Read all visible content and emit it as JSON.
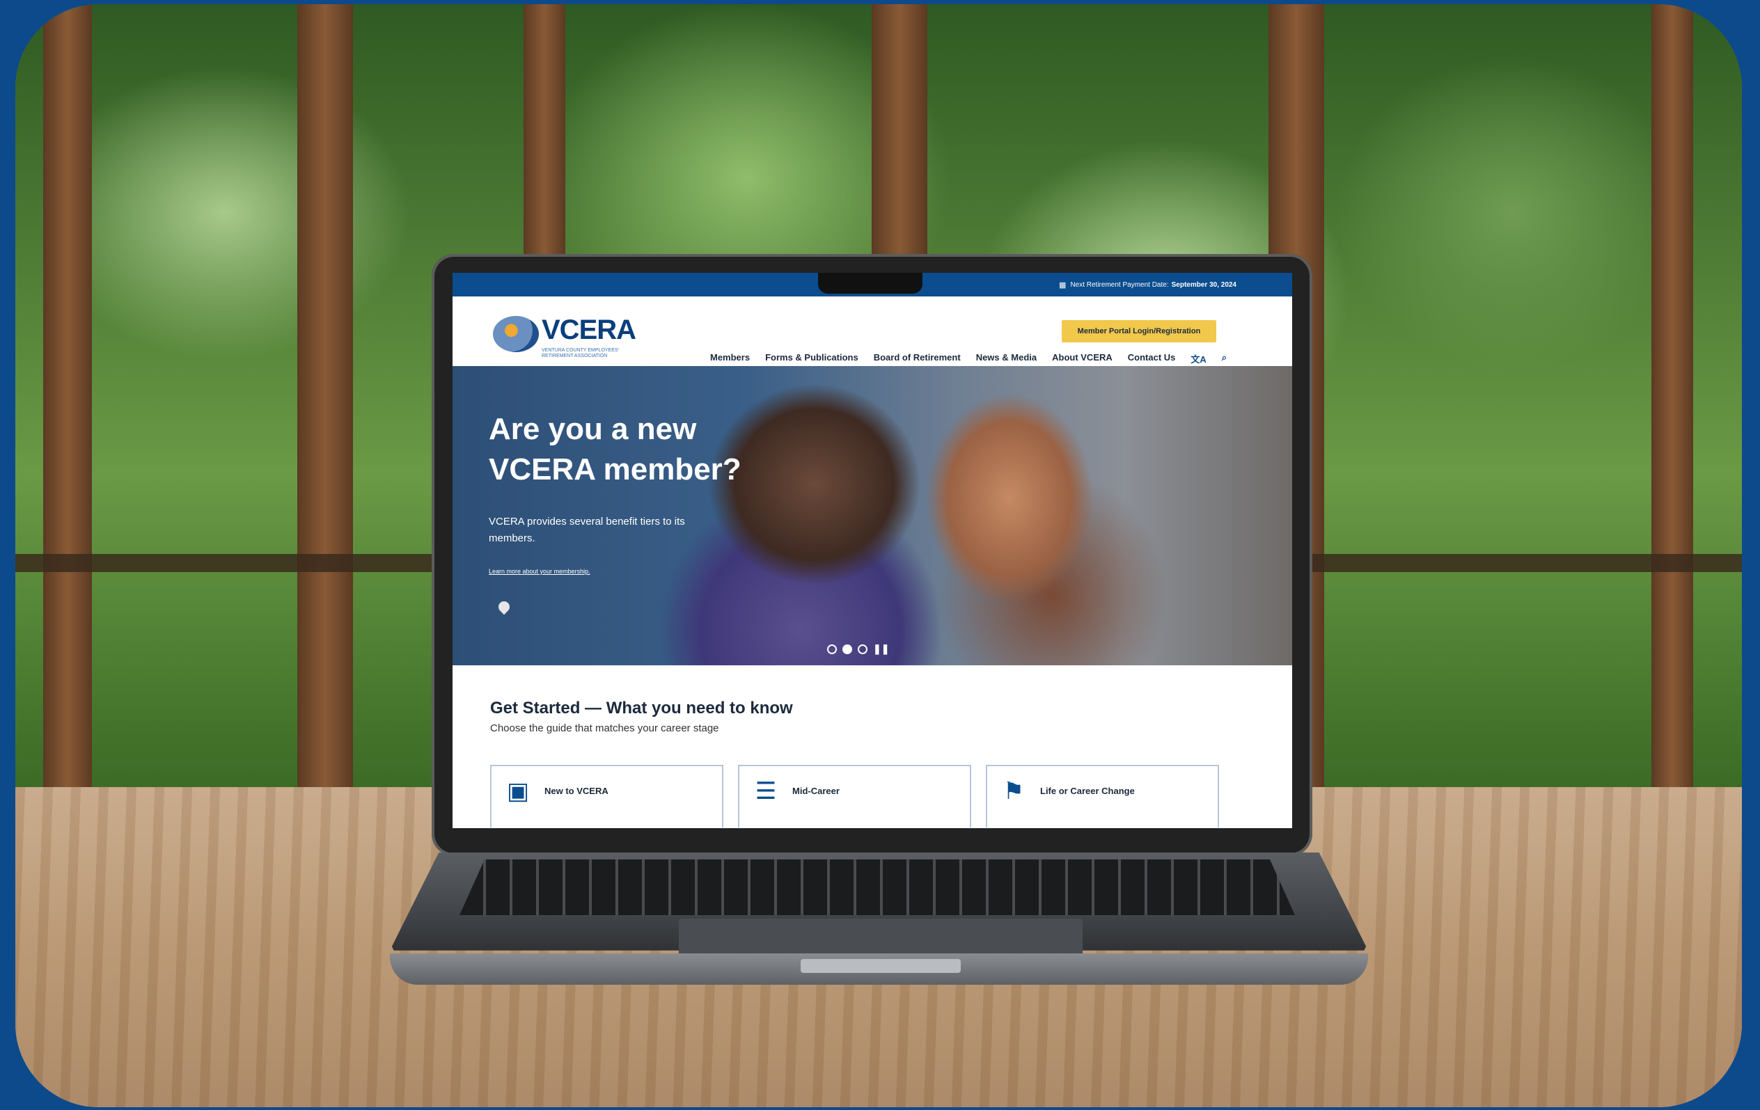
{
  "topbar": {
    "calendar_icon": "calendar-icon",
    "payment_label": "Next Retirement Payment Date:",
    "payment_date": "September 30, 2024"
  },
  "header": {
    "logo_text": "VCERA",
    "logo_subtext": "VENTURA COUNTY EMPLOYEES' RETIREMENT ASSOCIATION",
    "portal_button": "Member Portal Login/Registration",
    "nav": [
      "Members",
      "Forms & Publications",
      "Board of Retirement",
      "News & Media",
      "About VCERA",
      "Contact Us"
    ],
    "translate_icon": "translate-icon",
    "search_icon": "search-icon"
  },
  "hero": {
    "title": "Are you a new VCERA member?",
    "subtitle": "VCERA provides several benefit tiers to its members.",
    "link": "Learn more about your membership.",
    "slide_count": 3,
    "active_slide": 2
  },
  "get_started": {
    "title": "Get Started — What you need to know",
    "subtitle": "Choose the guide that matches your career stage",
    "cards": [
      {
        "label": "New to VCERA",
        "icon": "id-badge-icon"
      },
      {
        "label": "Mid-Career",
        "icon": "ladder-icon"
      },
      {
        "label": "Life or Career Change",
        "icon": "flag-icon"
      }
    ]
  },
  "colors": {
    "frame_bg": "#0c4a8c",
    "topbar": "#0b4d8e",
    "portal_button": "#f1c84b",
    "text_dark": "#1c2a3c"
  }
}
